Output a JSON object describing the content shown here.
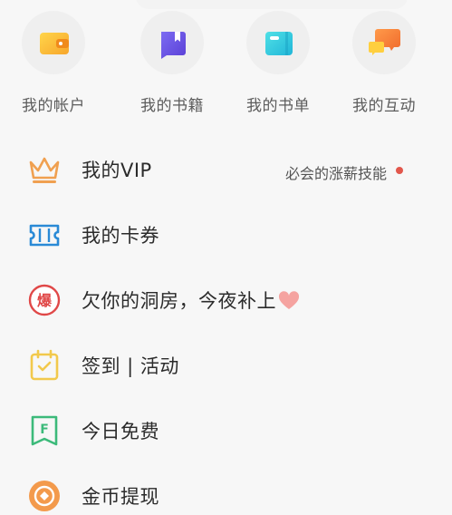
{
  "quick_actions": [
    {
      "label": "我的帐户",
      "icon": "wallet-icon"
    },
    {
      "label": "我的书籍",
      "icon": "book-bookmark-icon"
    },
    {
      "label": "我的书单",
      "icon": "booklist-icon"
    },
    {
      "label": "我的互动",
      "icon": "chat-bubbles-icon"
    }
  ],
  "menu": [
    {
      "label": "我的VIP",
      "icon": "crown-icon",
      "extra": "必会的涨薪技能",
      "has_dot": true
    },
    {
      "label": "我的卡券",
      "icon": "ticket-icon"
    },
    {
      "label": "欠你的洞房，今夜补上",
      "icon": "explosion-badge-icon",
      "badge_char": "爆",
      "trailing_icon": "heart-icon"
    },
    {
      "label": "签到 | 活动",
      "icon": "calendar-check-icon"
    },
    {
      "label": "今日免费",
      "icon": "free-flag-icon",
      "badge_char": "F"
    },
    {
      "label": "金币提现",
      "icon": "coin-icon"
    }
  ],
  "colors": {
    "background": "#f7f7f7",
    "accent_red": "#e2574c",
    "vip_orange": "#f0a050",
    "ticket_blue": "#2a8ad6",
    "calendar_yellow": "#f2c94c",
    "free_green": "#3cba7a",
    "coin_orange": "#f39a4c"
  }
}
